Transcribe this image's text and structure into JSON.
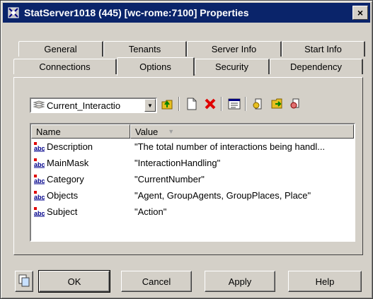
{
  "window": {
    "title": "StatServer1018 (445) [wc-rome:7100] Properties",
    "close_label": "×"
  },
  "tabs": {
    "row_back": [
      "General",
      "Tenants",
      "Server Info",
      "Start Info"
    ],
    "row_front": [
      "Connections",
      "Options",
      "Security",
      "Dependency"
    ],
    "active": "Options"
  },
  "toolbar": {
    "section_combo_value": "Current_Interactio",
    "icons": [
      "up-folder-icon",
      "new-icon",
      "delete-icon",
      "properties-icon",
      "import-icon",
      "export-icon",
      "copy-icon"
    ]
  },
  "list": {
    "columns": [
      "Name",
      "Value"
    ],
    "rows": [
      {
        "name": "Description",
        "value": "\"The total number of interactions being handl..."
      },
      {
        "name": "MainMask",
        "value": "\"InteractionHandling\""
      },
      {
        "name": "Category",
        "value": "\"CurrentNumber\""
      },
      {
        "name": "Objects",
        "value": "\"Agent, GroupAgents, GroupPlaces, Place\""
      },
      {
        "name": "Subject",
        "value": "\"Action\""
      }
    ]
  },
  "buttons": {
    "ok": "OK",
    "cancel": "Cancel",
    "apply": "Apply",
    "help": "Help"
  }
}
